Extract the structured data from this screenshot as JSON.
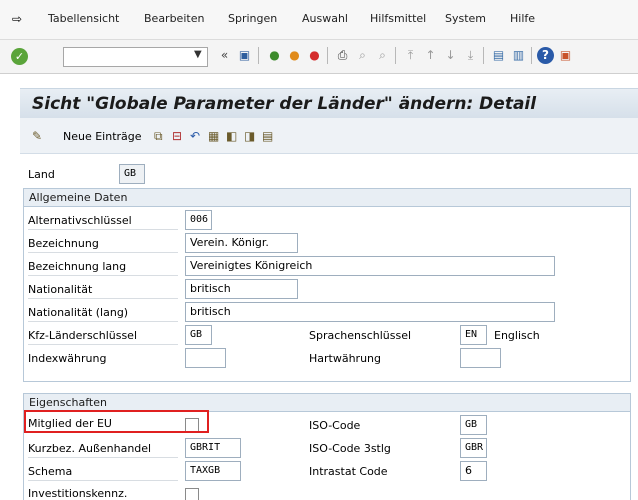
{
  "menubar": {
    "items": [
      "Tabellensicht",
      "Bearbeiten",
      "Springen",
      "Auswahl",
      "Hilfsmittel",
      "System",
      "Hilfe"
    ]
  },
  "title": "Sicht \"Globale Parameter der Länder\" ändern: Detail",
  "app_toolbar": {
    "new_entries_label": "Neue Einträge"
  },
  "key": {
    "label": "Land",
    "value": "GB"
  },
  "general": {
    "header": "Allgemeine Daten",
    "alt_key_label": "Alternativschlüssel",
    "alt_key_value": "006",
    "name_label": "Bezeichnung",
    "name_value": "Verein. Königr.",
    "name_long_label": "Bezeichnung lang",
    "name_long_value": "Vereinigtes Königreich",
    "nationality_label": "Nationalität",
    "nationality_value": "britisch",
    "nationality_long_label": "Nationalität (lang)",
    "nationality_long_value": "britisch",
    "vehicle_key_label": "Kfz-Länderschlüssel",
    "vehicle_key_value": "GB",
    "language_key_label": "Sprachenschlüssel",
    "language_key_value": "EN",
    "language_name": "Englisch",
    "index_currency_label": "Indexwährung",
    "index_currency_value": "",
    "hard_currency_label": "Hartwährung",
    "hard_currency_value": ""
  },
  "properties": {
    "header": "Eigenschaften",
    "eu_member_label": "Mitglied der EU",
    "eu_member_checked": false,
    "iso_code_label": "ISO-Code",
    "iso_code_value": "GB",
    "trade_short_label": "Kurzbez. Außenhandel",
    "trade_short_value": "GBRIT",
    "iso3_label": "ISO-Code 3stlg",
    "iso3_value": "GBR",
    "schema_label": "Schema",
    "schema_value": "TAXGB",
    "intrastat_label": "Intrastat Code",
    "intrastat_value": "6",
    "investment_label": "Investitionskennz.",
    "investment_checked": false
  }
}
